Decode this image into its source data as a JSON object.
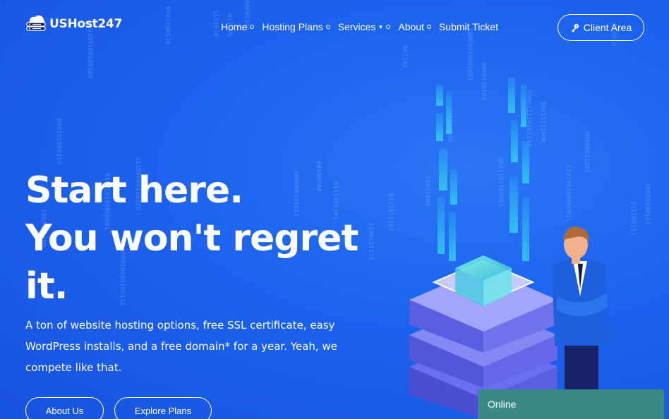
{
  "brand": {
    "name": "USHost247"
  },
  "nav": {
    "items": [
      {
        "label": "Home",
        "indicator": "dot"
      },
      {
        "label": "Hosting Plans",
        "indicator": "dot"
      },
      {
        "label": "Services",
        "indicator": "caret-dot"
      },
      {
        "label": "About",
        "indicator": "dot"
      },
      {
        "label": "Submit Ticket",
        "indicator": "none"
      }
    ],
    "client_area": {
      "label": "Client Area",
      "icon": "key-icon"
    }
  },
  "hero": {
    "headline_lines": [
      "Start here.",
      "You won't regret",
      "it."
    ],
    "subtext": "A ton of website hosting options, free SSL certificate, easy WordPress installs, and a free domain* for a year. Yeah, we compete like that.",
    "buttons": {
      "about": "About Us",
      "plans": "Explore Plans"
    }
  },
  "chat": {
    "status": "Online"
  },
  "colors": {
    "background": "#1c62ee",
    "chat": "#3a8a87",
    "accent_cyan": "#37d3f0"
  }
}
